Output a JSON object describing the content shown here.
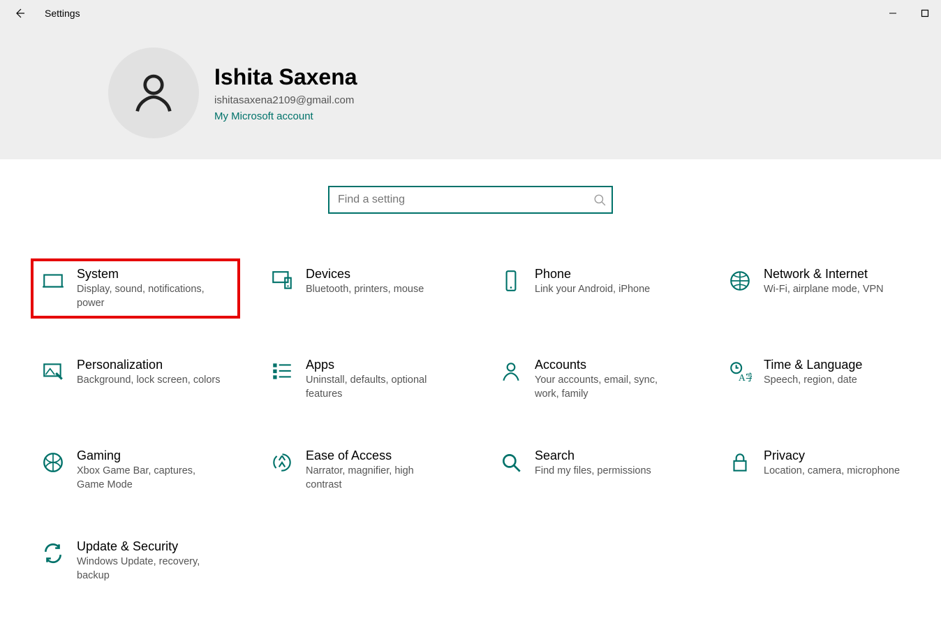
{
  "window": {
    "title": "Settings"
  },
  "user": {
    "name": "Ishita Saxena",
    "email": "ishitasaxena2109@gmail.com",
    "account_link": "My Microsoft account"
  },
  "search": {
    "placeholder": "Find a setting"
  },
  "categories": [
    {
      "id": "system",
      "title": "System",
      "desc": "Display, sound, notifications, power",
      "selected": true
    },
    {
      "id": "devices",
      "title": "Devices",
      "desc": "Bluetooth, printers, mouse",
      "selected": false
    },
    {
      "id": "phone",
      "title": "Phone",
      "desc": "Link your Android, iPhone",
      "selected": false
    },
    {
      "id": "network",
      "title": "Network & Internet",
      "desc": "Wi-Fi, airplane mode, VPN",
      "selected": false
    },
    {
      "id": "personalization",
      "title": "Personalization",
      "desc": "Background, lock screen, colors",
      "selected": false
    },
    {
      "id": "apps",
      "title": "Apps",
      "desc": "Uninstall, defaults, optional features",
      "selected": false
    },
    {
      "id": "accounts",
      "title": "Accounts",
      "desc": "Your accounts, email, sync, work, family",
      "selected": false
    },
    {
      "id": "time",
      "title": "Time & Language",
      "desc": "Speech, region, date",
      "selected": false
    },
    {
      "id": "gaming",
      "title": "Gaming",
      "desc": "Xbox Game Bar, captures, Game Mode",
      "selected": false
    },
    {
      "id": "ease",
      "title": "Ease of Access",
      "desc": "Narrator, magnifier, high contrast",
      "selected": false
    },
    {
      "id": "search",
      "title": "Search",
      "desc": "Find my files, permissions",
      "selected": false
    },
    {
      "id": "privacy",
      "title": "Privacy",
      "desc": "Location, camera, microphone",
      "selected": false
    },
    {
      "id": "update",
      "title": "Update & Security",
      "desc": "Windows Update, recovery, backup",
      "selected": false
    }
  ]
}
